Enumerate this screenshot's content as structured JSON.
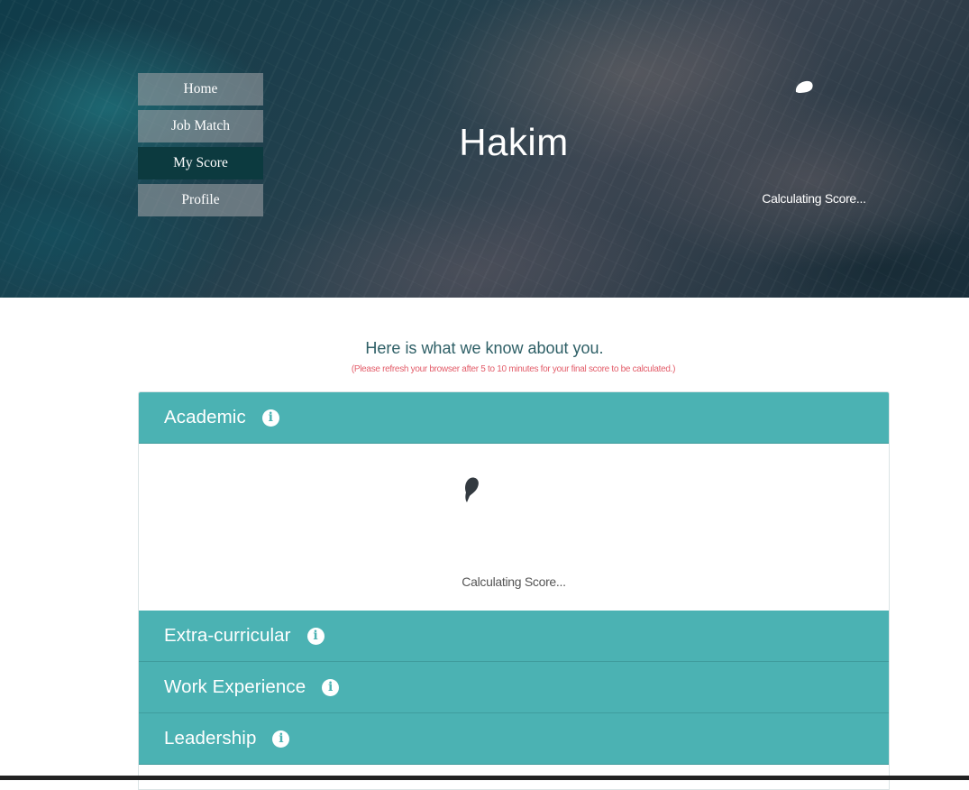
{
  "nav": {
    "items": [
      {
        "label": "Home",
        "active": false
      },
      {
        "label": "Job Match",
        "active": false
      },
      {
        "label": "My Score",
        "active": true
      },
      {
        "label": "Profile",
        "active": false
      }
    ]
  },
  "hero": {
    "name": "Hakim",
    "status": "Calculating Score..."
  },
  "main": {
    "intro": "Here is what we know about you.",
    "note": "(Please refresh your browser after 5 to 10 minutes for your final score to be calculated.)"
  },
  "sections": [
    {
      "title": "Academic",
      "expanded": true,
      "status": "Calculating Score..."
    },
    {
      "title": "Extra-curricular",
      "expanded": false
    },
    {
      "title": "Work Experience",
      "expanded": false
    },
    {
      "title": "Leadership",
      "expanded": false
    }
  ],
  "icons": {
    "info": "info-icon",
    "spinner": "spinner-icon"
  },
  "colors": {
    "accent": "#4bb2b3",
    "nav_active": "#0c3a3f",
    "note": "#e35d6a",
    "intro": "#2e5f66"
  }
}
